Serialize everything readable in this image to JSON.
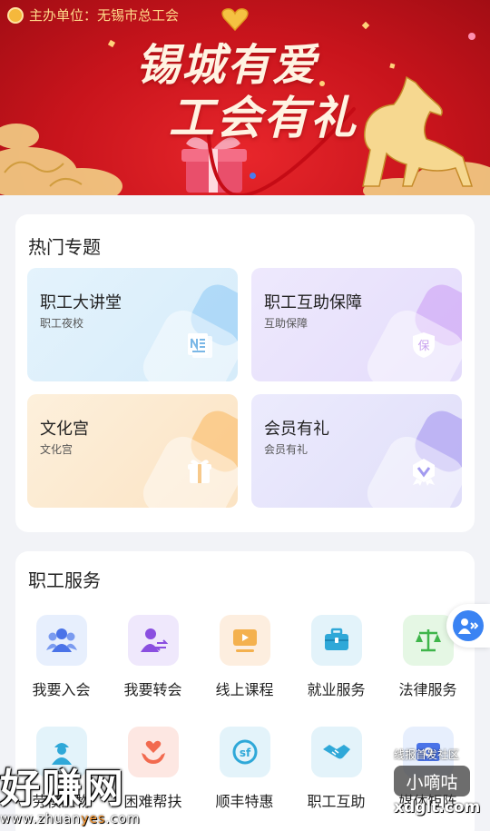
{
  "banner": {
    "sponsor": "主办单位：无锡市总工会",
    "title_line1": "锡城有爱",
    "title_line2": "工会有礼"
  },
  "hot_topics": {
    "title": "热门专题",
    "items": [
      {
        "name": "职工大讲堂",
        "sub": "职工夜校",
        "icon": "document-icon"
      },
      {
        "name": "职工互助保障",
        "sub": "互助保障",
        "icon": "shield-icon"
      },
      {
        "name": "文化宫",
        "sub": "文化宫",
        "icon": "gift-icon"
      },
      {
        "name": "会员有礼",
        "sub": "会员有礼",
        "icon": "badge-icon"
      }
    ]
  },
  "services": {
    "title": "职工服务",
    "items": [
      {
        "label": "我要入会",
        "icon": "group-icon"
      },
      {
        "label": "我要转会",
        "icon": "user-transfer-icon"
      },
      {
        "label": "线上课程",
        "icon": "video-icon"
      },
      {
        "label": "就业服务",
        "icon": "briefcase-icon"
      },
      {
        "label": "法律服务",
        "icon": "scale-icon"
      },
      {
        "label": "劳模人物",
        "icon": "worker-icon"
      },
      {
        "label": "困难帮扶",
        "icon": "heart-hands-icon"
      },
      {
        "label": "顺丰特惠",
        "icon": "sf-logo-icon"
      },
      {
        "label": "职工互助",
        "icon": "handshake-icon"
      },
      {
        "label": "媒体矩阵",
        "icon": "media-icon"
      }
    ]
  },
  "floating": {
    "icon": "user-forward-icon"
  },
  "watermarks": {
    "left_big": "好赚网",
    "left_url_a": "www.zhuan",
    "left_url_b": "yes",
    "left_url_c": ".com",
    "right_top": "线报首发社区",
    "right_mid": "小嘀咕",
    "right_domain": "xdglt.com"
  }
}
